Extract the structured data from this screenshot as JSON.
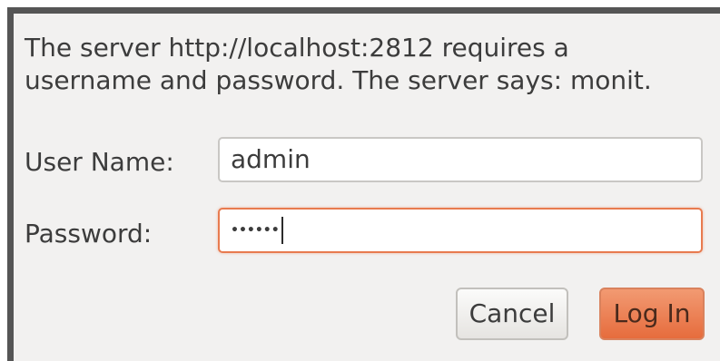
{
  "dialog": {
    "message_line1": "The server http://localhost:2812 requires a",
    "message_line2": "username and password. The server says: monit."
  },
  "form": {
    "username_label": "User Name:",
    "username_value": "admin",
    "password_label": "Password:",
    "password_mask": "••••••"
  },
  "buttons": {
    "cancel_label": "Cancel",
    "login_label": "Log In"
  },
  "colors": {
    "dialog_bg": "#f2f1f0",
    "focus_border": "#e87b4f",
    "accent_button": "#e66c3d"
  }
}
